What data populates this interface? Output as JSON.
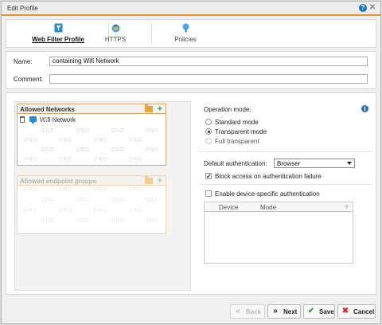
{
  "window": {
    "title": "Edit Profile",
    "help_glyph": "?",
    "close_glyph": "✕"
  },
  "tabs": [
    {
      "label": "Web Filter Profile",
      "icon": "filter-icon",
      "active": true
    },
    {
      "label": "HTTPS",
      "icon": "https-lock-icon",
      "active": false
    },
    {
      "label": "Policies",
      "icon": "policy-pin-icon",
      "active": false
    }
  ],
  "form": {
    "name_label": "Name:",
    "name_value": "containing Wifi Network",
    "comment_label": "Comment:",
    "comment_value": ""
  },
  "allowed_networks": {
    "title": "Allowed Networks",
    "items": [
      "Wifi Network"
    ],
    "dnd_text": "DND"
  },
  "allowed_endpoint_groups": {
    "title": "Allowed endpoint groups",
    "dnd_text": "DND"
  },
  "operation_mode": {
    "label": "Operation mode:",
    "options": [
      "Standard mode",
      "Transparent mode",
      "Full transparent"
    ],
    "selected": "Transparent mode"
  },
  "authentication": {
    "default_label": "Default authentication:",
    "default_value": "Browser",
    "block_label": "Block access on authentication failure",
    "block_checked": true,
    "device_specific_label": "Enable device-specific authentication",
    "device_specific_checked": false
  },
  "device_table": {
    "columns": [
      "Device",
      "Mode"
    ]
  },
  "footer": {
    "back_label": "Back",
    "next_label": "Next",
    "save_label": "Save",
    "cancel_label": "Cancel"
  },
  "colors": {
    "accent": "#e8902b",
    "add_green": "#3ba13b",
    "cancel_red": "#d32f2f",
    "info_blue": "#1b73c6"
  }
}
